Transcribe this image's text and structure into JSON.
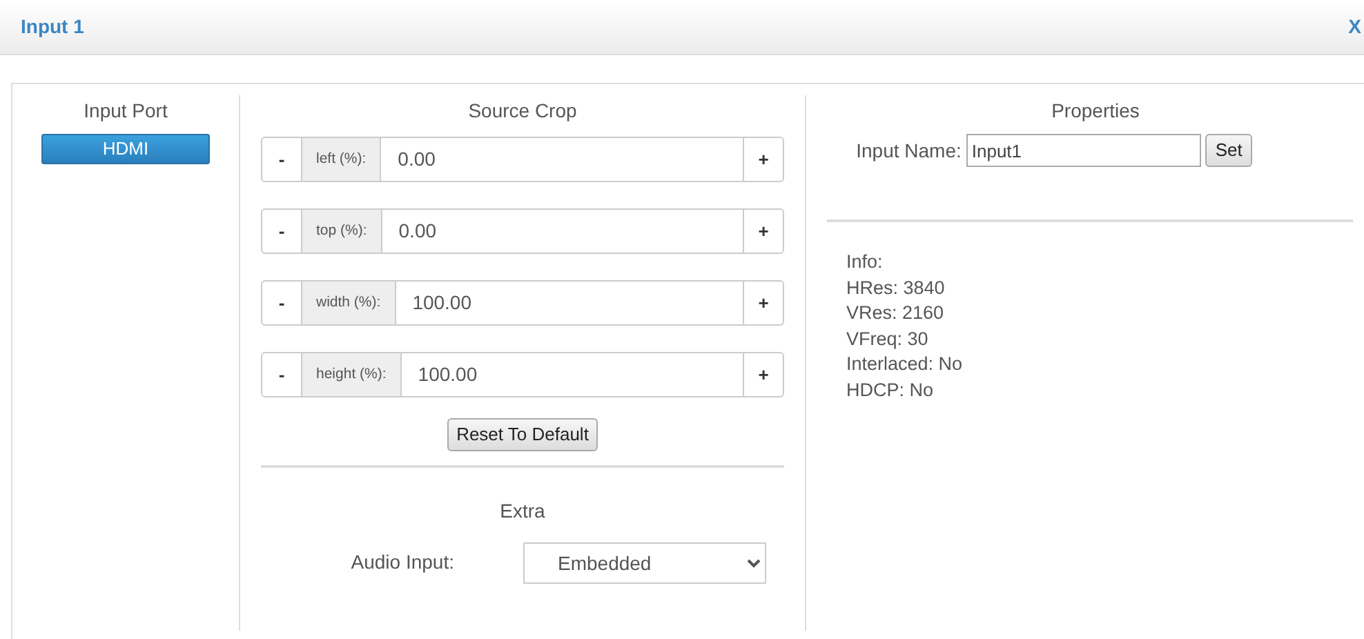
{
  "dialog": {
    "title": "Input 1",
    "close": "X"
  },
  "input_port": {
    "heading": "Input Port",
    "ports": [
      {
        "label": "HDMI",
        "selected": true
      }
    ]
  },
  "source_crop": {
    "heading": "Source Crop",
    "rows": [
      {
        "minus": "-",
        "label": "left (%):",
        "value": "0.00",
        "plus": "+"
      },
      {
        "minus": "-",
        "label": "top (%):",
        "value": "0.00",
        "plus": "+"
      },
      {
        "minus": "-",
        "label": "width (%):",
        "value": "100.00",
        "plus": "+"
      },
      {
        "minus": "-",
        "label": "height (%):",
        "value": "100.00",
        "plus": "+"
      }
    ],
    "reset_button": "Reset To Default"
  },
  "extra": {
    "heading": "Extra",
    "audio_input_label": "Audio Input:",
    "audio_input_value": "Embedded"
  },
  "properties": {
    "heading": "Properties",
    "input_name_label": "Input Name:",
    "input_name_value": "Input1",
    "set_button": "Set",
    "info": [
      "Info:",
      "HRes: 3840",
      "VRes: 2160",
      "VFreq: 30",
      "Interlaced: No",
      "HDCP: No"
    ]
  }
}
